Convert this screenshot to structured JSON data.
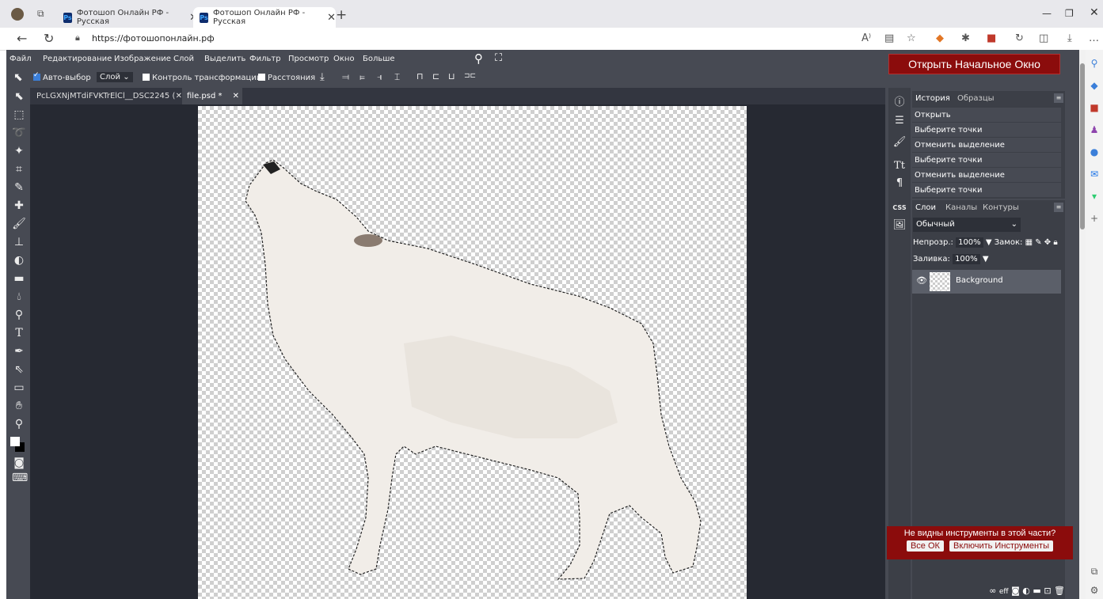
{
  "browser": {
    "tabs": [
      {
        "label": "Фотошоп Онлайн РФ - Русская",
        "icon": "photopea-icon"
      },
      {
        "label": "Фотошоп Онлайн РФ - Русская",
        "icon": "photopea-icon"
      }
    ],
    "url": "https://фотошопонлайн.рф"
  },
  "app": {
    "menu": [
      "Файл",
      "Редактирование",
      "Изображение",
      "Слой",
      "Выделить",
      "Фильтр",
      "Просмотр",
      "Окно",
      "Больше"
    ],
    "options": {
      "auto_select": "Авто-выбор",
      "layer_select": "Слой",
      "transform_controls": "Контроль трансформации",
      "distances": "Расстояния"
    },
    "doc_tabs": [
      "PcLGXNjMTdiFVKTrElCl__DSC2245 (",
      "file.psd *"
    ],
    "open_splash": "Открыть Начальное Окно",
    "history": {
      "tabs": [
        "История",
        "Образцы"
      ],
      "items": [
        "Открыть",
        "Выберите точки",
        "Отменить выделение",
        "Выберите точки",
        "Отменить выделение",
        "Выберите точки"
      ]
    },
    "layers": {
      "tabs": [
        "Слои",
        "Каналы",
        "Контуры"
      ],
      "blend_mode": "Обычный",
      "opacity_label": "Непрозр.:",
      "opacity": "100%",
      "lock_label": "Замок:",
      "fill_label": "Заливка:",
      "fill": "100%",
      "items": [
        "Background"
      ]
    },
    "notice": {
      "text": "Не видны инструменты в этой части?",
      "ok": "Все ОК",
      "enable": "Включить Инструменты"
    },
    "sidebar_css": "CSS"
  }
}
